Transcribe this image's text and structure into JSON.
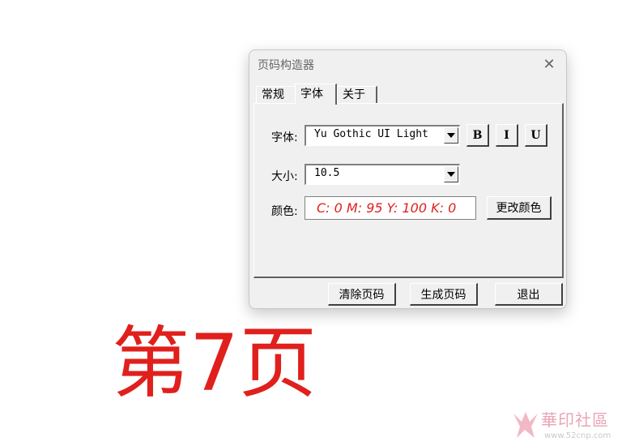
{
  "dialog": {
    "title": "页码构造器",
    "tabs": [
      {
        "label": "常规"
      },
      {
        "label": "字体"
      },
      {
        "label": "关于"
      }
    ],
    "font": {
      "label": "字体:",
      "value": "Yu Gothic UI Light",
      "bold_label": "B",
      "italic_label": "I",
      "underline_label": "U"
    },
    "size": {
      "label": "大小:",
      "value": "10.5"
    },
    "color": {
      "label": "颜色:",
      "value": "C: 0 M: 95 Y: 100 K: 0",
      "change_label": "更改颜色",
      "swatch": "#e0201c"
    },
    "buttons": {
      "clear": "清除页码",
      "generate": "生成页码",
      "exit": "退出"
    }
  },
  "preview_text": "第7页",
  "watermark": {
    "text": "華印社區",
    "url": "www.52cnp.com"
  }
}
